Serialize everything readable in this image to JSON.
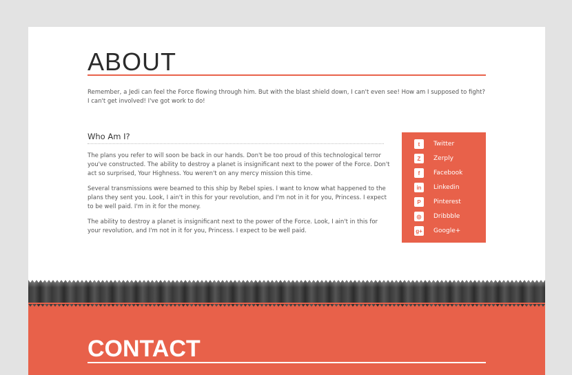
{
  "about": {
    "title": "ABOUT",
    "intro": "Remember, a Jedi can feel the Force flowing through him. But with the blast shield down, I can't even see! How am I supposed to fight? I can't get involved! I've got work to do!",
    "subheading": "Who Am I?",
    "paragraphs": [
      "The plans you refer to will soon be back in our hands. Don't be too proud of this technological terror you've constructed. The ability to destroy a planet is insignificant next to the power of the Force. Don't act so surprised, Your Highness. You weren't on any mercy mission this time.",
      "Several transmissions were beamed to this ship by Rebel spies. I want to know what happened to the plans they sent you. Look, I ain't in this for your revolution, and I'm not in it for you, Princess. I expect to be well paid. I'm in it for the money.",
      "The ability to destroy a planet is insignificant next to the power of the Force. Look, I ain't in this for your revolution, and I'm not in it for you, Princess. I expect to be well paid."
    ]
  },
  "social": {
    "items": [
      {
        "label": "Twitter",
        "icon": "twitter-icon",
        "glyph": "t"
      },
      {
        "label": "Zerply",
        "icon": "zerply-icon",
        "glyph": "Z"
      },
      {
        "label": "Facebook",
        "icon": "facebook-icon",
        "glyph": "f"
      },
      {
        "label": "Linkedin",
        "icon": "linkedin-icon",
        "glyph": "in"
      },
      {
        "label": "Pinterest",
        "icon": "pinterest-icon",
        "glyph": "P"
      },
      {
        "label": "Dribbble",
        "icon": "dribbble-icon",
        "glyph": "◎"
      },
      {
        "label": "Google+",
        "icon": "google-plus-icon",
        "glyph": "g+"
      }
    ]
  },
  "contact": {
    "title": "CONTACT"
  },
  "colors": {
    "accent": "#e8614a",
    "background": "#e3e3e3",
    "card": "#ffffff"
  }
}
